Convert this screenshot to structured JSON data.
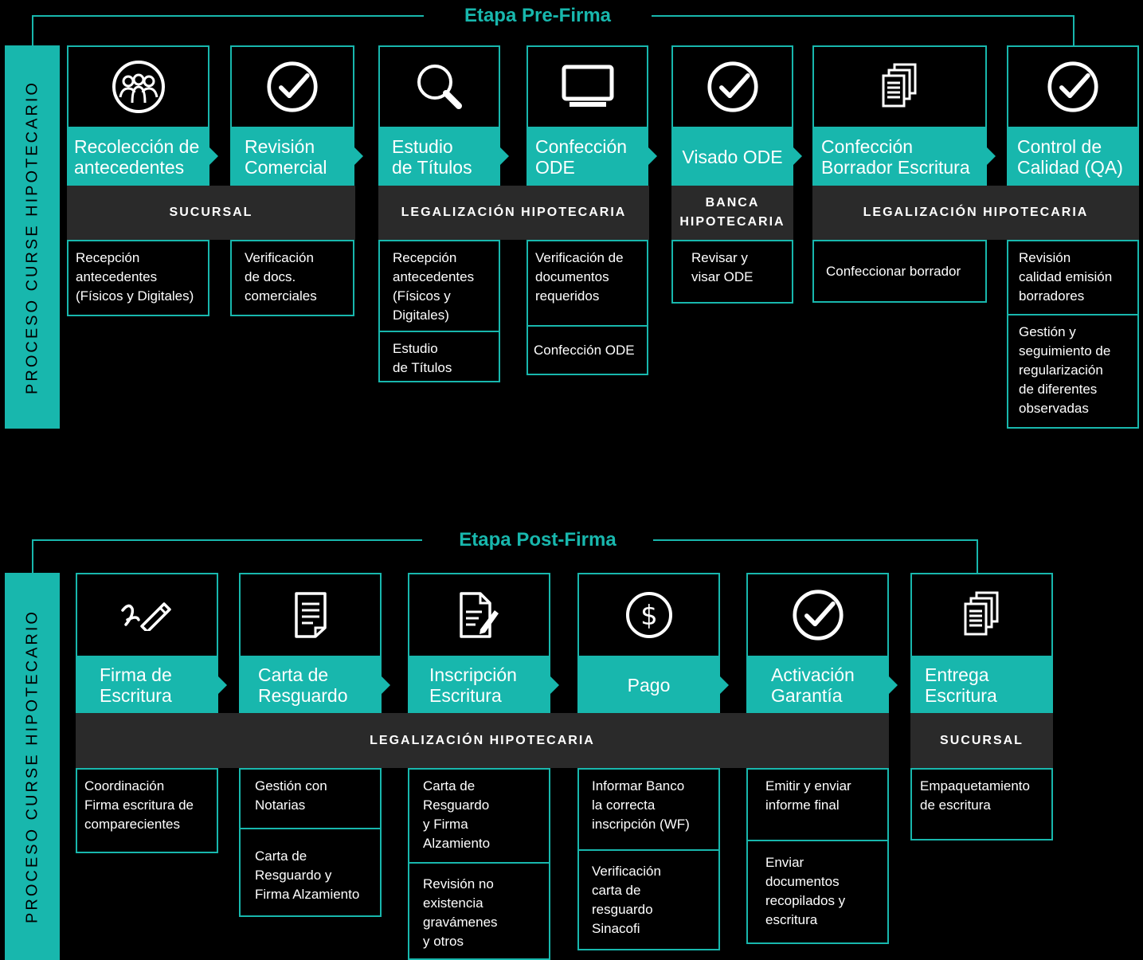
{
  "colors": {
    "accent": "#18b7ad",
    "background": "#000000",
    "area_band": "#2a2a2a"
  },
  "pre": {
    "title": "Etapa Pre-Firma",
    "side_label": "PROCESO CURSE HIPOTECARIO",
    "steps": [
      {
        "label": "Recolección de\nantecedentes",
        "icon": "group-icon"
      },
      {
        "label": "Revisión\nComercial",
        "icon": "check-circle-icon"
      },
      {
        "label": "Estudio\nde Títulos",
        "icon": "magnifier-icon"
      },
      {
        "label": "Confección\nODE",
        "icon": "monitor-icon"
      },
      {
        "label": "Visado ODE",
        "icon": "check-circle-icon"
      },
      {
        "label": "Confección\nBorrador Escritura",
        "icon": "documents-icon"
      },
      {
        "label": "Control de\nCalidad (QA)",
        "icon": "check-circle-icon"
      }
    ],
    "areas": [
      "SUCURSAL",
      "LEGALIZACIÓN HIPOTECARIA",
      "BANCA\nHIPOTECARIA",
      "LEGALIZACIÓN HIPOTECARIA"
    ],
    "tasks": [
      "Recepción\nantecedentes\n(Físicos y Digitales)",
      "Verificación\nde docs.\ncomerciales",
      "Recepción\nantecedentes\n(Físicos y\nDigitales)",
      "Estudio\nde Títulos",
      "Verificación de\ndocumentos\nrequeridos",
      "Confección ODE",
      "Revisar y\nvisar ODE",
      "Confeccionar borrador",
      "Revisión\ncalidad emisión\nborradores",
      "Gestión y\nseguimiento de\nregularización\nde diferentes\nobservadas"
    ]
  },
  "post": {
    "title": "Etapa Post-Firma",
    "side_label": "PROCESO CURSE HIPOTECARIO",
    "steps": [
      {
        "label": "Firma de\nEscritura",
        "icon": "signature-pen-icon"
      },
      {
        "label": "Carta de\nResguardo",
        "icon": "document-icon"
      },
      {
        "label": "Inscripción\nEscritura",
        "icon": "document-edit-icon"
      },
      {
        "label": "Pago",
        "icon": "dollar-icon"
      },
      {
        "label": "Activación\nGarantía",
        "icon": "check-circle-icon"
      },
      {
        "label": "Entrega\nEscritura",
        "icon": "documents-icon"
      }
    ],
    "areas": [
      "LEGALIZACIÓN HIPOTECARIA",
      "SUCURSAL"
    ],
    "tasks": [
      "Coordinación\nFirma escritura de\ncomparecientes",
      "Gestión con\nNotarias",
      "Carta de\nResguardo y\nFirma Alzamiento",
      "Carta de\nResguardo\ny Firma\nAlzamiento",
      "Revisión no\nexistencia\ngravámenes\ny otros",
      "Informar Banco\nla correcta\ninscripción (WF)",
      "Verificación\ncarta de\nresguardo\nSinacofi",
      "Emitir y enviar\ninforme final",
      "Enviar\ndocumentos\nrecopilados y\nescritura",
      "Empaquetamiento\nde escritura"
    ]
  }
}
